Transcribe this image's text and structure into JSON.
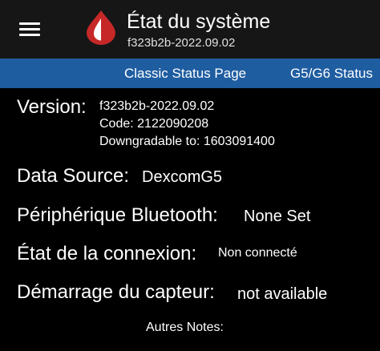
{
  "header": {
    "title": "État du système",
    "subtitle": "f323b2b-2022.09.02",
    "menu_icon": "hamburger-menu-icon",
    "logo_icon": "blood-drop-logo-icon",
    "colors": {
      "appbar_bg": "#161616",
      "logo_red": "#c62828"
    }
  },
  "tabs": {
    "items": [
      {
        "label": "Classic Status Page"
      },
      {
        "label": "G5/G6 Status"
      }
    ],
    "bar_color": "#1f5da1"
  },
  "status": {
    "version": {
      "label": "Version:",
      "lines": [
        "f323b2b-2022.09.02",
        "Code: 2122090208",
        "Downgradable to: 1603091400"
      ]
    },
    "data_source": {
      "label": "Data Source:",
      "value": "DexcomG5"
    },
    "bluetooth": {
      "label": "Périphérique Bluetooth:",
      "value": "None Set"
    },
    "connection": {
      "label": "État de la connexion:",
      "value": "Non connecté"
    },
    "sensor_start": {
      "label": "Démarrage du capteur:",
      "value": "not available"
    },
    "notes_label": "Autres Notes:"
  }
}
